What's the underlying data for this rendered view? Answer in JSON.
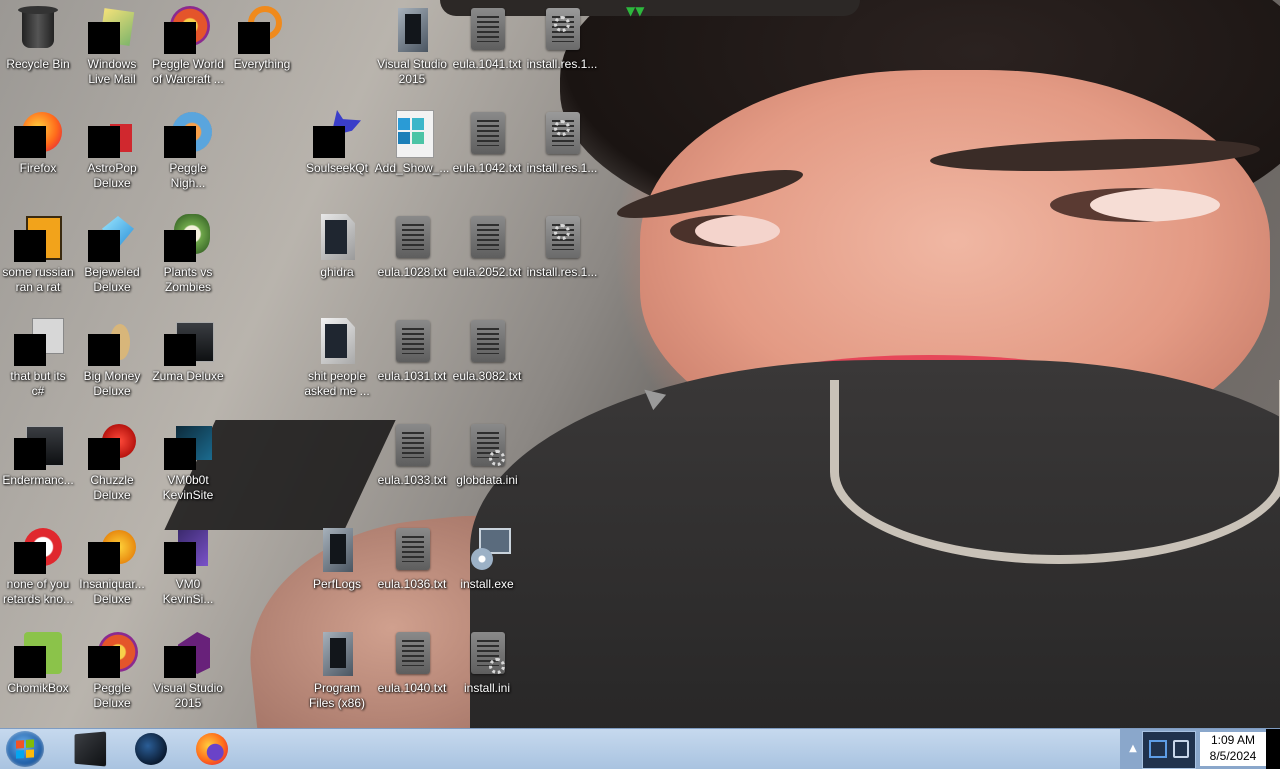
{
  "desktop": {
    "icons": [
      {
        "label": "Recycle Bin",
        "icon": "recycle-bin-icon"
      },
      {
        "label": "Windows\nLive Mail",
        "icon": "mail-icon"
      },
      {
        "label": "Peggle World\nof Warcraft ...",
        "icon": "peggle-icon"
      },
      {
        "label": "Everything",
        "icon": "search-app-icon"
      },
      {
        "label": "Visual Studio\n2015",
        "icon": "visual-studio-icon"
      },
      {
        "label": "eula.1041.txt",
        "icon": "text-file-icon"
      },
      {
        "label": "install.res.1...",
        "icon": "settings-file-icon"
      },
      {
        "label": "Firefox",
        "icon": "firefox-icon"
      },
      {
        "label": "AstroPop\nDeluxe",
        "icon": "game-icon"
      },
      {
        "label": "Peggle\nNigh...",
        "icon": "peggle-icon"
      },
      {
        "label": "SoulseekQt",
        "icon": "bird-icon"
      },
      {
        "label": "Add_Show_...",
        "icon": "registry-file-icon"
      },
      {
        "label": "eula.1042.txt",
        "icon": "text-file-icon"
      },
      {
        "label": "install.res.1...",
        "icon": "settings-file-icon"
      },
      {
        "label": "some russian\nran a rat",
        "icon": "image-file-icon"
      },
      {
        "label": "Bejeweled\nDeluxe",
        "icon": "gem-icon"
      },
      {
        "label": "Plants vs\nZombies",
        "icon": "game-icon"
      },
      {
        "label": "ghidra",
        "icon": "folder-icon"
      },
      {
        "label": "eula.1028.txt",
        "icon": "text-file-icon"
      },
      {
        "label": "eula.2052.txt",
        "icon": "text-file-icon"
      },
      {
        "label": "install.res.1...",
        "icon": "settings-file-icon"
      },
      {
        "label": "that but its\nc#",
        "icon": "shortcut-icon"
      },
      {
        "label": "Big Money\nDeluxe",
        "icon": "game-icon"
      },
      {
        "label": "Zuma Deluxe",
        "icon": "game-icon"
      },
      {
        "label": "shit people\nasked me ...",
        "icon": "folder-icon"
      },
      {
        "label": "eula.1031.txt",
        "icon": "text-file-icon"
      },
      {
        "label": "eula.3082.txt",
        "icon": "text-file-icon"
      },
      {
        "label": "Endermanc...",
        "icon": "app-icon"
      },
      {
        "label": "Chuzzle\nDeluxe",
        "icon": "game-icon"
      },
      {
        "label": "VM0b0t\nKevinSite",
        "icon": "app-icon"
      },
      {
        "label": "eula.1033.txt",
        "icon": "text-file-icon"
      },
      {
        "label": "globdata.ini",
        "icon": "settings-file-icon"
      },
      {
        "label": "none of you\nretards kno...",
        "icon": "app-icon"
      },
      {
        "label": "Insaniquar...\nDeluxe",
        "icon": "game-icon"
      },
      {
        "label": "VM0\nKevinSi...",
        "icon": "app-icon"
      },
      {
        "label": "PerfLogs",
        "icon": "folder-icon"
      },
      {
        "label": "eula.1036.txt",
        "icon": "text-file-icon"
      },
      {
        "label": "install.exe",
        "icon": "installer-icon"
      },
      {
        "label": "ChomikBox",
        "icon": "app-icon"
      },
      {
        "label": "Peggle\nDeluxe",
        "icon": "peggle-icon"
      },
      {
        "label": "Visual Studio\n2015",
        "icon": "visual-studio-icon"
      },
      {
        "label": "Program\nFiles (x86)",
        "icon": "folder-icon"
      },
      {
        "label": "eula.1040.txt",
        "icon": "text-file-icon"
      },
      {
        "label": "install.ini",
        "icon": "settings-file-icon"
      }
    ]
  },
  "taskbar": {
    "start_icon": "windows-start-icon",
    "pinned": [
      "command-prompt-icon",
      "steam-icon",
      "firefox-icon"
    ],
    "clock": {
      "time": "1:09 AM",
      "date": "8/5/2024"
    }
  },
  "colors": {
    "taskbar": "#b7cfe8",
    "tray": "#8aa7cb",
    "label_text": "#ffffff"
  }
}
